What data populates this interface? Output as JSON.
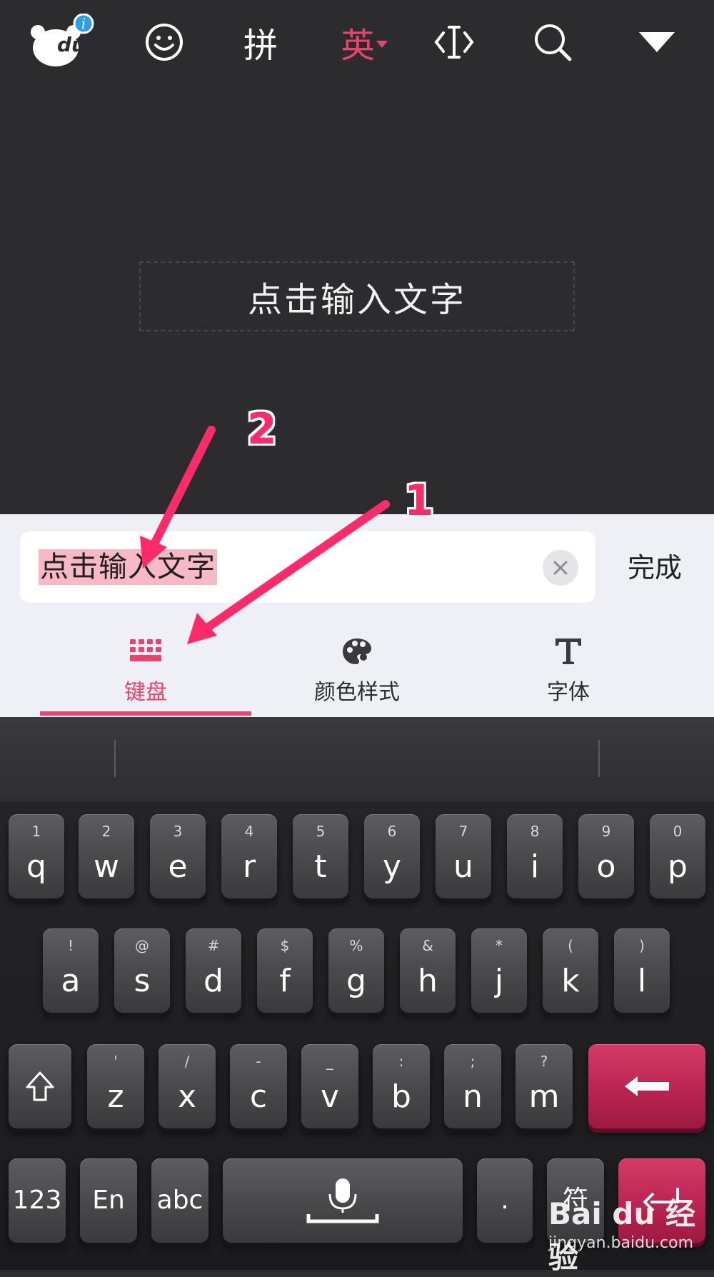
{
  "canvas": {
    "placeholder_text": "点击输入文字"
  },
  "input": {
    "value": "点击输入文字",
    "done_label": "完成"
  },
  "tabs": [
    {
      "label": "键盘",
      "icon": "keyboard-icon",
      "active": true
    },
    {
      "label": "颜色样式",
      "icon": "palette-icon",
      "active": false
    },
    {
      "label": "字体",
      "icon": "font-t-icon",
      "active": false
    }
  ],
  "toolbar": {
    "items": [
      {
        "icon": "du-bear-logo-icon",
        "logo_text": "du"
      },
      {
        "icon": "smiley-icon"
      },
      {
        "label": "拼"
      },
      {
        "label": "英"
      },
      {
        "icon": "cursor-icon"
      },
      {
        "icon": "search-icon"
      },
      {
        "icon": "collapse-down-icon"
      }
    ]
  },
  "keyboard": {
    "row1": [
      {
        "sub": "1",
        "main": "q"
      },
      {
        "sub": "2",
        "main": "w"
      },
      {
        "sub": "3",
        "main": "e"
      },
      {
        "sub": "4",
        "main": "r"
      },
      {
        "sub": "5",
        "main": "t"
      },
      {
        "sub": "6",
        "main": "y"
      },
      {
        "sub": "7",
        "main": "u"
      },
      {
        "sub": "8",
        "main": "i"
      },
      {
        "sub": "9",
        "main": "o"
      },
      {
        "sub": "0",
        "main": "p"
      }
    ],
    "row2": [
      {
        "sub": "!",
        "main": "a"
      },
      {
        "sub": "@",
        "main": "s"
      },
      {
        "sub": "#",
        "main": "d"
      },
      {
        "sub": "$",
        "main": "f"
      },
      {
        "sub": "%",
        "main": "g"
      },
      {
        "sub": "&",
        "main": "h"
      },
      {
        "sub": "*",
        "main": "j"
      },
      {
        "sub": "(",
        "main": "k"
      },
      {
        "sub": ")",
        "main": "l"
      }
    ],
    "row3": [
      {
        "sub": "'",
        "main": "z"
      },
      {
        "sub": "/",
        "main": "x"
      },
      {
        "sub": "-",
        "main": "c"
      },
      {
        "sub": "_",
        "main": "v"
      },
      {
        "sub": ":",
        "main": "b"
      },
      {
        "sub": ";",
        "main": "n"
      },
      {
        "sub": "?",
        "main": "m"
      }
    ],
    "row4": {
      "num_label": "123",
      "en_label": "En",
      "abc_label": "abc",
      "period_label": ".",
      "symbol_label": "符"
    }
  },
  "annotations": {
    "arrow1_label": "1",
    "arrow2_label": "2",
    "arrow_color": "#ff2a6a"
  },
  "watermark": {
    "logo": "Bai du 经验",
    "url": "jingyan.baidu.com"
  },
  "colors": {
    "accent": "#e8446d",
    "selection": "#f7b9c7",
    "panel": "#eef0f5",
    "key_red": "#c12656"
  }
}
